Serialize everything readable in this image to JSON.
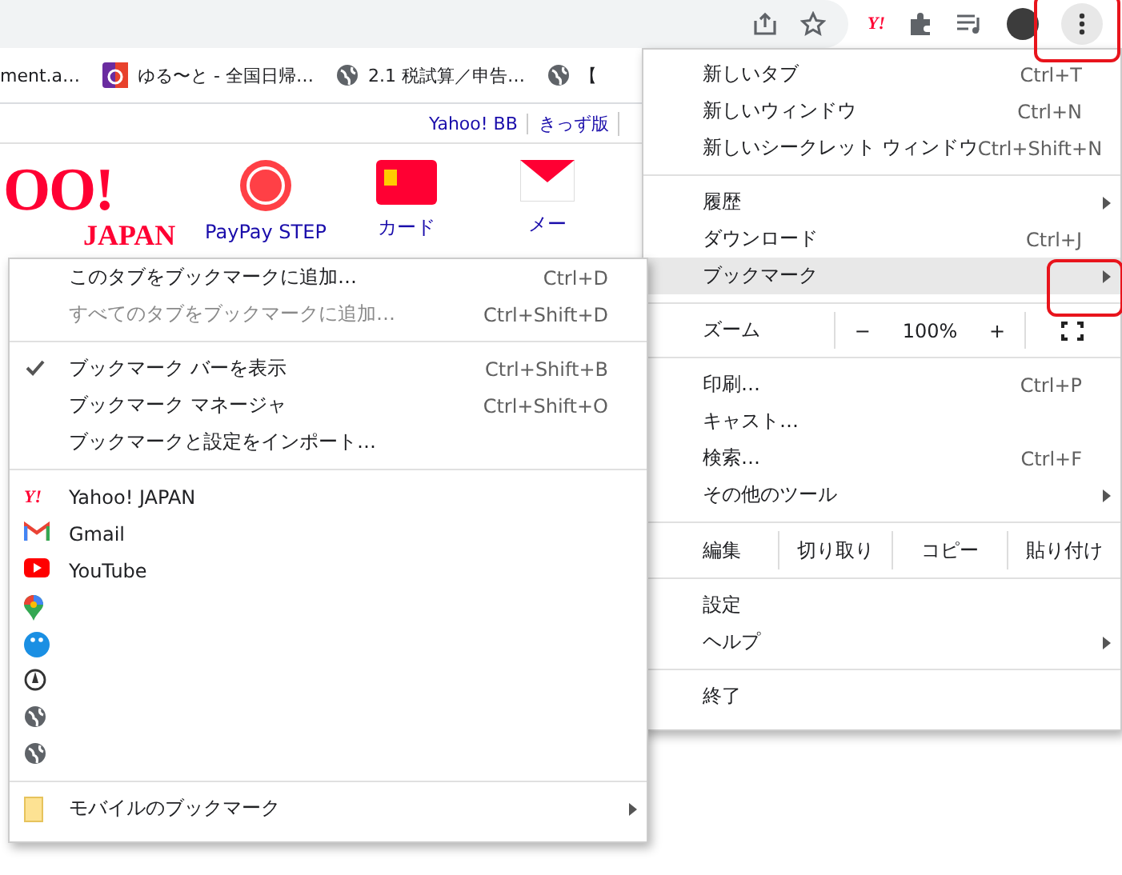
{
  "toolbar": {
    "extension_label": "Y!"
  },
  "bookmarks_bar": [
    {
      "label": "ment.a…"
    },
    {
      "label": "ゆる〜と - 全国日帰…"
    },
    {
      "label": "2.1 税試算／申告…"
    },
    {
      "label": "【"
    }
  ],
  "page": {
    "links": [
      "Yahoo! BB",
      "きっず版"
    ],
    "logo": {
      "line1": "OO!",
      "line2": "JAPAN"
    },
    "services": [
      {
        "label": "PayPay STEP"
      },
      {
        "label": "カード"
      },
      {
        "label": "メー"
      }
    ]
  },
  "main_menu": {
    "sections": [
      [
        {
          "kind": "item",
          "label": "新しいタブ",
          "shortcut": "Ctrl+T",
          "submenu": false,
          "selected": false
        },
        {
          "kind": "item",
          "label": "新しいウィンドウ",
          "shortcut": "Ctrl+N",
          "submenu": false,
          "selected": false
        },
        {
          "kind": "item",
          "label": "新しいシークレット ウィンドウ",
          "shortcut": "Ctrl+Shift+N",
          "submenu": false,
          "selected": false
        }
      ],
      [
        {
          "kind": "item",
          "label": "履歴",
          "submenu": true,
          "selected": false
        },
        {
          "kind": "item",
          "label": "ダウンロード",
          "shortcut": "Ctrl+J",
          "submenu": false,
          "selected": false
        },
        {
          "kind": "item",
          "label": "ブックマーク",
          "submenu": true,
          "selected": true
        }
      ],
      [
        {
          "kind": "zoom",
          "label": "ズーム",
          "minus": "−",
          "value": "100%",
          "plus": "+"
        }
      ],
      [
        {
          "kind": "item",
          "label": "印刷…",
          "shortcut": "Ctrl+P",
          "submenu": false,
          "selected": false
        },
        {
          "kind": "item",
          "label": "キャスト…",
          "submenu": false,
          "selected": false
        },
        {
          "kind": "item",
          "label": "検索…",
          "shortcut": "Ctrl+F",
          "submenu": false,
          "selected": false
        },
        {
          "kind": "item",
          "label": "その他のツール",
          "submenu": true,
          "selected": false
        }
      ],
      [
        {
          "kind": "edit",
          "label": "編集",
          "buttons": [
            "切り取り",
            "コピー",
            "貼り付け"
          ]
        }
      ],
      [
        {
          "kind": "item",
          "label": "設定",
          "submenu": false,
          "selected": false
        },
        {
          "kind": "item",
          "label": "ヘルプ",
          "submenu": true,
          "selected": false
        }
      ],
      [
        {
          "kind": "item",
          "label": "終了",
          "submenu": false,
          "selected": false
        }
      ]
    ]
  },
  "bookmark_menu": {
    "sections": [
      [
        {
          "kind": "command",
          "label": "このタブをブックマークに追加…",
          "shortcut": "Ctrl+D",
          "disabled": false,
          "checked": false
        },
        {
          "kind": "command",
          "label": "すべてのタブをブックマークに追加…",
          "shortcut": "Ctrl+Shift+D",
          "disabled": true,
          "checked": false
        }
      ],
      [
        {
          "kind": "command",
          "label": "ブックマーク バーを表示",
          "shortcut": "Ctrl+Shift+B",
          "disabled": false,
          "checked": true
        },
        {
          "kind": "command",
          "label": "ブックマーク マネージャ",
          "shortcut": "Ctrl+Shift+O",
          "disabled": false,
          "checked": false
        },
        {
          "kind": "command",
          "label": "ブックマークと設定をインポート…",
          "disabled": false,
          "checked": false
        }
      ],
      [
        {
          "kind": "bookmark",
          "label": "Yahoo! JAPAN",
          "icon_text": "Y!"
        },
        {
          "kind": "bookmark",
          "label": "Gmail"
        },
        {
          "kind": "bookmark",
          "label": "YouTube"
        },
        {
          "kind": "bookmark"
        },
        {
          "kind": "bookmark"
        },
        {
          "kind": "bookmark"
        },
        {
          "kind": "bookmark"
        },
        {
          "kind": "bookmark"
        }
      ],
      [
        {
          "kind": "folder",
          "label": "モバイルのブックマーク",
          "submenu": true
        }
      ]
    ]
  },
  "annotations": [
    {
      "kind": "red-box"
    },
    {
      "kind": "red-box"
    }
  ]
}
